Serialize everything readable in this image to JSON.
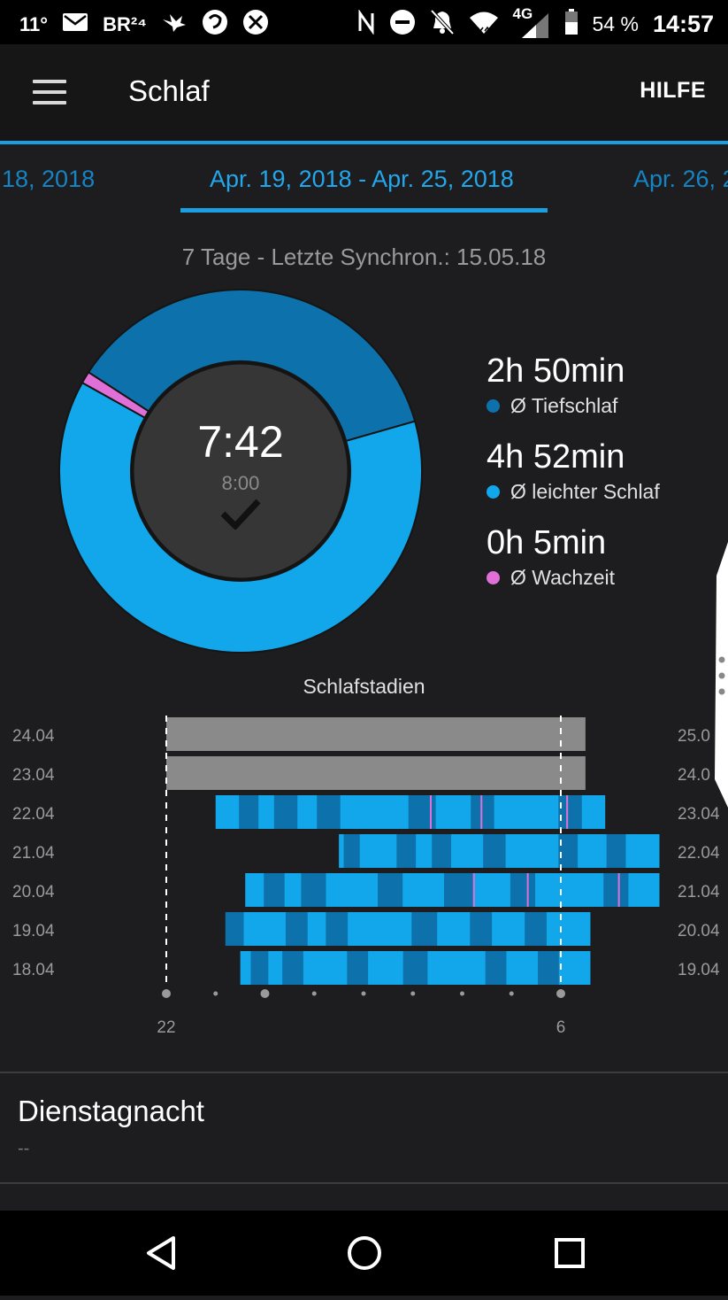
{
  "status_bar": {
    "temperature": "11°",
    "br_label": "BR²⁴",
    "network": "4G",
    "battery": "54 %",
    "time": "14:57"
  },
  "app_bar": {
    "title": "Schlaf",
    "help": "HILFE"
  },
  "date_tabs": [
    {
      "label": "18, 2018"
    },
    {
      "label": "Apr. 19, 2018 - Apr. 25, 2018"
    },
    {
      "label": "Apr. 26, 2"
    }
  ],
  "sync_text": "7 Tage - Letzte Synchron.: 15.05.18",
  "summary": {
    "total": "7:42",
    "goal": "8:00",
    "stats": [
      {
        "value": "2h 50min",
        "label": "Ø Tiefschlaf",
        "color": "#0d72ac"
      },
      {
        "value": "4h 52min",
        "label": "Ø leichter Schlaf",
        "color": "#12a6ea"
      },
      {
        "value": "0h 5min",
        "label": "Ø Wachzeit",
        "color": "#e070d8"
      }
    ]
  },
  "colors": {
    "deep": "#0d72ac",
    "light": "#12a6ea",
    "awake": "#e070d8",
    "nodata": "#8a8a8a",
    "accent": "#1aa0e0"
  },
  "chart_data": {
    "type": "bar",
    "title": "Schlafstadien",
    "x_ticks": [
      "22",
      "6"
    ],
    "rows": [
      {
        "start_label": "24.04",
        "end_label": "25.0",
        "start": 22.0,
        "end": 30.5,
        "stage": "nodata"
      },
      {
        "start_label": "23.04",
        "end_label": "24.0",
        "start": 22.0,
        "end": 30.5,
        "stage": "nodata"
      },
      {
        "start_label": "22.04",
        "end_label": "23.04",
        "start": 23.0,
        "end": 30.9,
        "stage": "mixed"
      },
      {
        "start_label": "21.04",
        "end_label": "22.04",
        "start": 25.5,
        "end": 32.0,
        "stage": "mixed"
      },
      {
        "start_label": "20.04",
        "end_label": "21.04",
        "start": 23.6,
        "end": 32.0,
        "stage": "mixed"
      },
      {
        "start_label": "19.04",
        "end_label": "20.04",
        "start": 23.2,
        "end": 30.6,
        "stage": "mixed"
      },
      {
        "start_label": "18.04",
        "end_label": "19.04",
        "start": 23.5,
        "end": 30.6,
        "stage": "mixed"
      }
    ],
    "donut": {
      "deep_min": 170,
      "light_min": 292,
      "awake_min": 5
    }
  },
  "list": {
    "title": "Dienstagnacht",
    "subtitle": "--"
  }
}
